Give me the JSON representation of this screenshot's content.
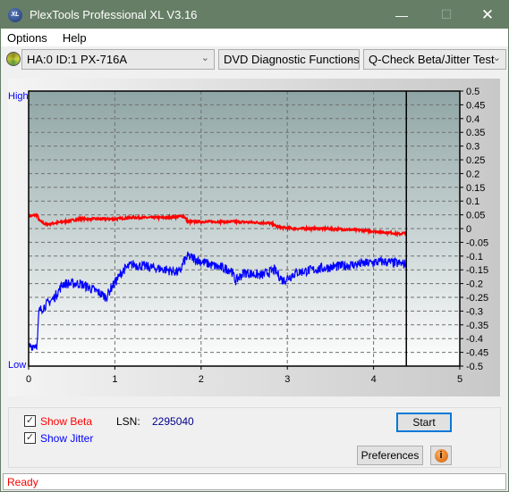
{
  "window": {
    "title": "PlexTools Professional XL V3.16",
    "logo_text": "XL"
  },
  "menu": {
    "items": [
      {
        "label": "Options",
        "key": "O"
      },
      {
        "label": "Help",
        "key": "H"
      }
    ]
  },
  "toolbar": {
    "drive": "HA:0 ID:1  PX-716A",
    "function": "DVD Diagnostic Functions",
    "test": "Q-Check Beta/Jitter Test"
  },
  "chart_data": {
    "type": "line",
    "left_labels": {
      "high": "High",
      "low": "Low"
    },
    "xlim": [
      0,
      5
    ],
    "ylim": [
      -0.5,
      0.5
    ],
    "x_ticks": [
      "0",
      "1",
      "2",
      "3",
      "4",
      "5"
    ],
    "y_ticks": [
      "0.5",
      "0.45",
      "0.4",
      "0.35",
      "0.3",
      "0.25",
      "0.2",
      "0.15",
      "0.1",
      "0.05",
      "0",
      "-0.05",
      "-0.1",
      "-0.15",
      "-0.2",
      "-0.25",
      "-0.3",
      "-0.35",
      "-0.4",
      "-0.45",
      "-0.5"
    ],
    "grid": true,
    "cursor_x": 4.38,
    "colors": {
      "beta": "#ff0000",
      "jitter": "#0000ff",
      "cursor": "#000000"
    },
    "series": [
      {
        "name": "Beta",
        "x": [
          0,
          0.1,
          0.12,
          0.2,
          0.4,
          0.6,
          0.8,
          1.0,
          1.2,
          1.4,
          1.6,
          1.8,
          1.85,
          2.0,
          2.4,
          2.8,
          2.9,
          3.1,
          3.4,
          3.8,
          4.2,
          4.3,
          4.38
        ],
        "y": [
          0.045,
          0.05,
          0.03,
          0.015,
          0.025,
          0.035,
          0.035,
          0.035,
          0.04,
          0.04,
          0.04,
          0.045,
          0.025,
          0.025,
          0.025,
          0.02,
          0.005,
          0.0,
          0.0,
          -0.005,
          -0.015,
          -0.02,
          -0.015
        ]
      },
      {
        "name": "Jitter",
        "x": [
          0,
          0.1,
          0.12,
          0.3,
          0.4,
          0.6,
          0.8,
          0.9,
          0.95,
          1.1,
          1.2,
          1.4,
          1.6,
          1.75,
          1.8,
          1.85,
          2.0,
          2.2,
          2.35,
          2.4,
          2.5,
          2.7,
          2.85,
          2.95,
          3.1,
          3.3,
          3.5,
          3.8,
          4.1,
          4.38
        ],
        "y": [
          -0.43,
          -0.42,
          -0.3,
          -0.25,
          -0.2,
          -0.2,
          -0.23,
          -0.25,
          -0.22,
          -0.15,
          -0.13,
          -0.14,
          -0.15,
          -0.16,
          -0.12,
          -0.1,
          -0.12,
          -0.14,
          -0.15,
          -0.19,
          -0.16,
          -0.17,
          -0.15,
          -0.19,
          -0.16,
          -0.15,
          -0.14,
          -0.13,
          -0.12,
          -0.13
        ]
      }
    ]
  },
  "controls": {
    "show_beta": "Show Beta",
    "show_jitter": "Show Jitter",
    "lsn_label": "LSN:",
    "lsn_value": "2295040",
    "start": "Start",
    "preferences": "Preferences",
    "show_beta_checked": true,
    "show_jitter_checked": true
  },
  "status": {
    "text": "Ready"
  }
}
